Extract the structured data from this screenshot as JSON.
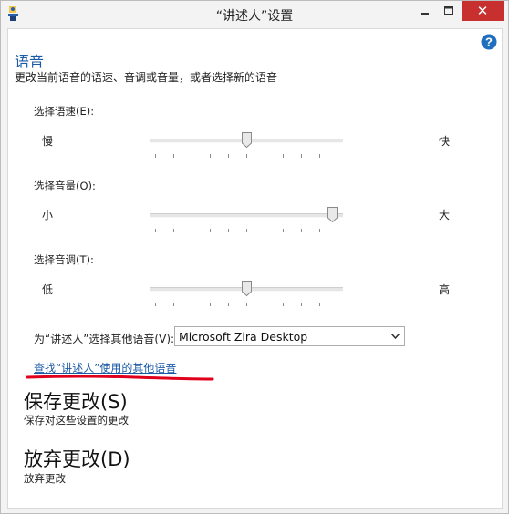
{
  "window": {
    "title": "“讲述人”设置",
    "minimize_icon": "minimize-icon",
    "maximize_icon": "maximize-icon",
    "close_icon": "close-icon",
    "close_color": "#c7302e"
  },
  "help": {
    "icon": "help-icon",
    "color": "#1f6fbf"
  },
  "voice_section": {
    "title": "语音",
    "description": "更改当前语音的语速、音调或音量，或者选择新的语音"
  },
  "speed": {
    "label": "选择语速(E):",
    "low": "慢",
    "high": "快",
    "value_fraction": 0.5
  },
  "volume": {
    "label": "选择音量(O):",
    "low": "小",
    "high": "大",
    "value_fraction": 0.97
  },
  "pitch": {
    "label": "选择音调(T):",
    "low": "低",
    "high": "高",
    "value_fraction": 0.5
  },
  "voice_select": {
    "label": "为“讲述人”选择其他语音(V):",
    "value": "Microsoft Zira Desktop"
  },
  "find_voices_link": "查找“讲述人”使用的其他语音",
  "annotation_color": "#e0001b",
  "save": {
    "title": "保存更改(S)",
    "description": "保存对这些设置的更改"
  },
  "discard": {
    "title": "放弃更改(D)",
    "description": "放弃更改"
  }
}
